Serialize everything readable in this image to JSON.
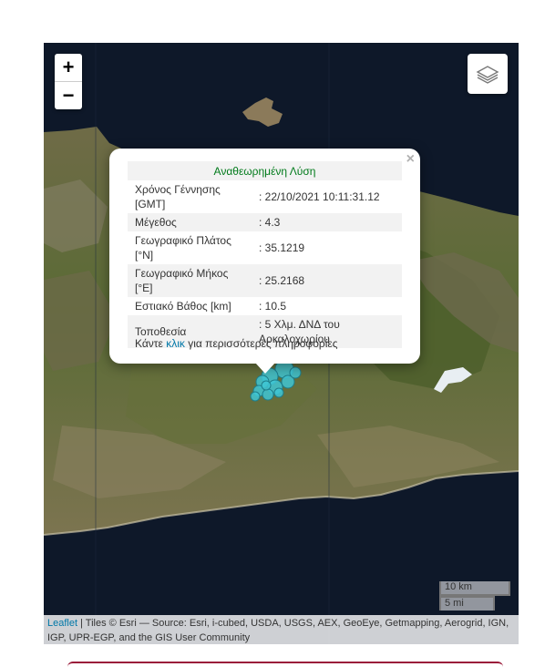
{
  "map": {
    "zoom_in_label": "+",
    "zoom_out_label": "−",
    "layers_icon": "layers-icon",
    "marker_color": "#3fc6d4"
  },
  "popup": {
    "title": "Αναθεωρημένη Λύση",
    "rows": [
      {
        "label": "Χρόνος Γέννησης [GMT]",
        "value": ": 22/10/2021 10:11:31.12"
      },
      {
        "label": "Μέγεθος",
        "value": ": 4.3"
      },
      {
        "label": "Γεωγραφικό Πλάτος [°N]",
        "value": ": 35.1219"
      },
      {
        "label": "Γεωγραφικό Μήκος [°E]",
        "value": ": 25.2168"
      },
      {
        "label": "Εστιακό Βάθος [km]",
        "value": ": 10.5"
      },
      {
        "label": "Τοποθεσία",
        "value": ": 5 Χλμ. ΔΝΔ του Αρκαλοχωρίου"
      }
    ],
    "more_prefix": "Κάντε ",
    "more_link": "κλικ",
    "more_suffix": " για περισσότερες πληροφορίες",
    "close_label": "×"
  },
  "scale": {
    "km_label": "10 km",
    "mi_label": "5 mi"
  },
  "attribution": {
    "leaflet_link": "Leaflet",
    "text": " | Tiles © Esri — Source: Esri, i-cubed, USDA, USGS, AEX, GeoEye, Getmapping, Aerogrid, IGN, IGP, UPR-EGP, and the GIS User Community"
  }
}
